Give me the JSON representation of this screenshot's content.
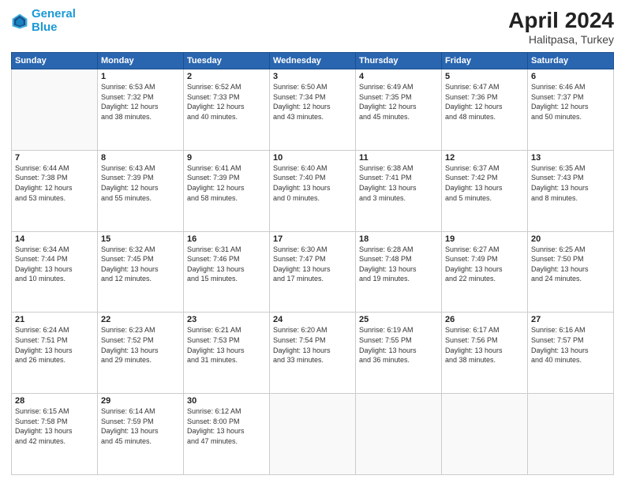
{
  "header": {
    "logo_line1": "General",
    "logo_line2": "Blue",
    "title": "April 2024",
    "location": "Halitpasa, Turkey"
  },
  "weekdays": [
    "Sunday",
    "Monday",
    "Tuesday",
    "Wednesday",
    "Thursday",
    "Friday",
    "Saturday"
  ],
  "weeks": [
    [
      {
        "day": "",
        "info": ""
      },
      {
        "day": "1",
        "info": "Sunrise: 6:53 AM\nSunset: 7:32 PM\nDaylight: 12 hours\nand 38 minutes."
      },
      {
        "day": "2",
        "info": "Sunrise: 6:52 AM\nSunset: 7:33 PM\nDaylight: 12 hours\nand 40 minutes."
      },
      {
        "day": "3",
        "info": "Sunrise: 6:50 AM\nSunset: 7:34 PM\nDaylight: 12 hours\nand 43 minutes."
      },
      {
        "day": "4",
        "info": "Sunrise: 6:49 AM\nSunset: 7:35 PM\nDaylight: 12 hours\nand 45 minutes."
      },
      {
        "day": "5",
        "info": "Sunrise: 6:47 AM\nSunset: 7:36 PM\nDaylight: 12 hours\nand 48 minutes."
      },
      {
        "day": "6",
        "info": "Sunrise: 6:46 AM\nSunset: 7:37 PM\nDaylight: 12 hours\nand 50 minutes."
      }
    ],
    [
      {
        "day": "7",
        "info": "Sunrise: 6:44 AM\nSunset: 7:38 PM\nDaylight: 12 hours\nand 53 minutes."
      },
      {
        "day": "8",
        "info": "Sunrise: 6:43 AM\nSunset: 7:39 PM\nDaylight: 12 hours\nand 55 minutes."
      },
      {
        "day": "9",
        "info": "Sunrise: 6:41 AM\nSunset: 7:39 PM\nDaylight: 12 hours\nand 58 minutes."
      },
      {
        "day": "10",
        "info": "Sunrise: 6:40 AM\nSunset: 7:40 PM\nDaylight: 13 hours\nand 0 minutes."
      },
      {
        "day": "11",
        "info": "Sunrise: 6:38 AM\nSunset: 7:41 PM\nDaylight: 13 hours\nand 3 minutes."
      },
      {
        "day": "12",
        "info": "Sunrise: 6:37 AM\nSunset: 7:42 PM\nDaylight: 13 hours\nand 5 minutes."
      },
      {
        "day": "13",
        "info": "Sunrise: 6:35 AM\nSunset: 7:43 PM\nDaylight: 13 hours\nand 8 minutes."
      }
    ],
    [
      {
        "day": "14",
        "info": "Sunrise: 6:34 AM\nSunset: 7:44 PM\nDaylight: 13 hours\nand 10 minutes."
      },
      {
        "day": "15",
        "info": "Sunrise: 6:32 AM\nSunset: 7:45 PM\nDaylight: 13 hours\nand 12 minutes."
      },
      {
        "day": "16",
        "info": "Sunrise: 6:31 AM\nSunset: 7:46 PM\nDaylight: 13 hours\nand 15 minutes."
      },
      {
        "day": "17",
        "info": "Sunrise: 6:30 AM\nSunset: 7:47 PM\nDaylight: 13 hours\nand 17 minutes."
      },
      {
        "day": "18",
        "info": "Sunrise: 6:28 AM\nSunset: 7:48 PM\nDaylight: 13 hours\nand 19 minutes."
      },
      {
        "day": "19",
        "info": "Sunrise: 6:27 AM\nSunset: 7:49 PM\nDaylight: 13 hours\nand 22 minutes."
      },
      {
        "day": "20",
        "info": "Sunrise: 6:25 AM\nSunset: 7:50 PM\nDaylight: 13 hours\nand 24 minutes."
      }
    ],
    [
      {
        "day": "21",
        "info": "Sunrise: 6:24 AM\nSunset: 7:51 PM\nDaylight: 13 hours\nand 26 minutes."
      },
      {
        "day": "22",
        "info": "Sunrise: 6:23 AM\nSunset: 7:52 PM\nDaylight: 13 hours\nand 29 minutes."
      },
      {
        "day": "23",
        "info": "Sunrise: 6:21 AM\nSunset: 7:53 PM\nDaylight: 13 hours\nand 31 minutes."
      },
      {
        "day": "24",
        "info": "Sunrise: 6:20 AM\nSunset: 7:54 PM\nDaylight: 13 hours\nand 33 minutes."
      },
      {
        "day": "25",
        "info": "Sunrise: 6:19 AM\nSunset: 7:55 PM\nDaylight: 13 hours\nand 36 minutes."
      },
      {
        "day": "26",
        "info": "Sunrise: 6:17 AM\nSunset: 7:56 PM\nDaylight: 13 hours\nand 38 minutes."
      },
      {
        "day": "27",
        "info": "Sunrise: 6:16 AM\nSunset: 7:57 PM\nDaylight: 13 hours\nand 40 minutes."
      }
    ],
    [
      {
        "day": "28",
        "info": "Sunrise: 6:15 AM\nSunset: 7:58 PM\nDaylight: 13 hours\nand 42 minutes."
      },
      {
        "day": "29",
        "info": "Sunrise: 6:14 AM\nSunset: 7:59 PM\nDaylight: 13 hours\nand 45 minutes."
      },
      {
        "day": "30",
        "info": "Sunrise: 6:12 AM\nSunset: 8:00 PM\nDaylight: 13 hours\nand 47 minutes."
      },
      {
        "day": "",
        "info": ""
      },
      {
        "day": "",
        "info": ""
      },
      {
        "day": "",
        "info": ""
      },
      {
        "day": "",
        "info": ""
      }
    ]
  ]
}
